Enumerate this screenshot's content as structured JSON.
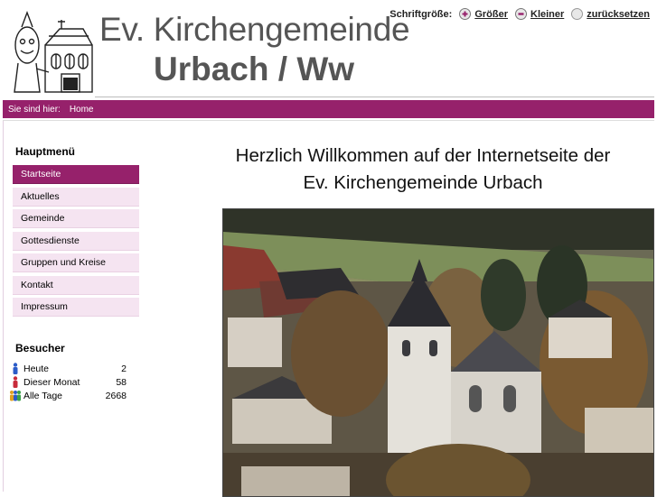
{
  "header": {
    "title_line1": "Ev. Kirchengemeinde",
    "title_line2": "Urbach / Ww"
  },
  "fontsize": {
    "label": "Schriftgröße:",
    "bigger": "Größer",
    "smaller": "Kleiner",
    "reset": "zurücksetzen"
  },
  "breadcrumb": {
    "label": "Sie sind hier:",
    "home": "Home"
  },
  "main_menu": {
    "title": "Hauptmenü",
    "items": [
      {
        "label": "Startseite"
      },
      {
        "label": "Aktuelles"
      },
      {
        "label": "Gemeinde"
      },
      {
        "label": "Gottesdienste"
      },
      {
        "label": "Gruppen und Kreise"
      },
      {
        "label": "Kontakt"
      },
      {
        "label": "Impressum"
      }
    ]
  },
  "visitors": {
    "title": "Besucher",
    "rows": [
      {
        "label": "Heute",
        "value": "2"
      },
      {
        "label": "Dieser Monat",
        "value": "58"
      },
      {
        "label": "Alle Tage",
        "value": "2668"
      }
    ]
  },
  "content": {
    "welcome_line1": "Herzlich Willkommen auf der Internetseite der",
    "welcome_line2": "Ev. Kirchengemeinde Urbach"
  },
  "colors": {
    "accent": "#96216b",
    "menu_bg": "#f5e4f1",
    "title_gray": "#555555"
  }
}
